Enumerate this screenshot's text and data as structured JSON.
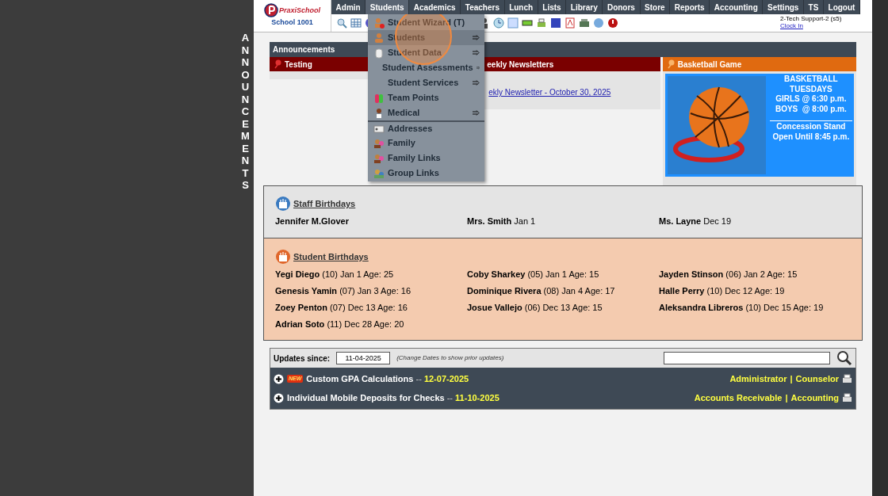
{
  "side_label": "ANNOUNCEMENTS",
  "logo": {
    "brand": "PraxiSchool",
    "school": "School 1001"
  },
  "nav": [
    {
      "label": "Admin",
      "selected": false
    },
    {
      "label": "Students",
      "selected": true
    },
    {
      "label": "Academics",
      "selected": false
    },
    {
      "label": "Teachers",
      "selected": false
    },
    {
      "label": "Lunch",
      "selected": false
    },
    {
      "label": "Lists",
      "selected": false
    },
    {
      "label": "Library",
      "selected": false
    },
    {
      "label": "Donors",
      "selected": false
    },
    {
      "label": "Store",
      "selected": false
    },
    {
      "label": "Reports",
      "selected": false
    },
    {
      "label": "Accounting",
      "selected": false
    },
    {
      "label": "Settings",
      "selected": false
    },
    {
      "label": "TS",
      "selected": false
    },
    {
      "label": "Logout",
      "selected": false
    }
  ],
  "user": {
    "name": "2-Tech Support-2 (s5)",
    "link": "Clock In"
  },
  "menu": [
    {
      "label": "Student Wizard (T)",
      "kind": "wizard",
      "submenu": false,
      "selected": false
    },
    {
      "label": "Students",
      "kind": "person",
      "submenu": true,
      "selected": true
    },
    {
      "label": "Student Data",
      "kind": "data",
      "submenu": true,
      "selected": false
    },
    {
      "label": "Student Assessments",
      "kind": "plain",
      "submenu": true,
      "selected": false
    },
    {
      "label": "Student Services",
      "kind": "plain",
      "submenu": true,
      "selected": false
    },
    {
      "label": "Team Points",
      "kind": "team",
      "submenu": false,
      "selected": false
    },
    {
      "label": "Medical",
      "kind": "medical",
      "submenu": true,
      "selected": false
    },
    {
      "label": "Addresses",
      "kind": "card",
      "submenu": false,
      "selected": false,
      "divider": true
    },
    {
      "label": "Family",
      "kind": "family",
      "submenu": false,
      "selected": false
    },
    {
      "label": "Family Links",
      "kind": "family",
      "submenu": false,
      "selected": false
    },
    {
      "label": "Group Links",
      "kind": "group",
      "submenu": false,
      "selected": false
    }
  ],
  "announcements": {
    "title": "Announcements",
    "columns": [
      {
        "title": "Testing",
        "color": "#7a0000"
      },
      {
        "title": "eekly Newsletters",
        "color": "#7a0000",
        "link": "ekly Newsletter - October 30, 2025"
      },
      {
        "title": "Basketball Game",
        "color": "#e06a10",
        "flyer": [
          "BASKETBALL",
          "TUESDAYS",
          "GIRLS @ 6:30 p.m.",
          "BOYS  @ 8:00 p.m.",
          "Concession Stand",
          "Open Until 8:45 p.m."
        ]
      }
    ]
  },
  "staff_birthdays": {
    "title": "Staff Birthdays",
    "people": [
      {
        "name": "Jennifer M.Glover"
      },
      {
        "name": "Mrs. Smith",
        "detail": "Jan 1"
      },
      {
        "name": "Ms. Layne",
        "detail": "Dec 19"
      }
    ]
  },
  "student_birthdays": {
    "title": "Student Birthdays",
    "people": [
      {
        "name": "Yegi Diego",
        "detail": "(10) Jan 1 Age: 25"
      },
      {
        "name": "Coby Sharkey",
        "detail": "(05) Jan 1 Age: 15"
      },
      {
        "name": "Jayden Stinson",
        "detail": "(06) Jan 2 Age: 15"
      },
      {
        "name": "Genesis Yamin",
        "detail": "(07) Jan 3 Age: 16"
      },
      {
        "name": "Dominique Rivera",
        "detail": "(08) Jan 4 Age: 17"
      },
      {
        "name": "Halle Perry",
        "detail": "(10) Dec 12 Age: 19"
      },
      {
        "name": "Zoey Penton",
        "detail": "(07) Dec 13 Age: 16"
      },
      {
        "name": "Josue Vallejo",
        "detail": "(06) Dec 13 Age: 15"
      },
      {
        "name": "Aleksandra Libreros",
        "detail": "(10) Dec 15 Age: 19"
      },
      {
        "name": "Adrian Soto",
        "detail": "(11) Dec 28 Age: 20"
      }
    ]
  },
  "updates": {
    "label": "Updates since:",
    "date": "11-04-2025",
    "hint": "(Change Dates to show prior updates)",
    "items": [
      {
        "title": "Custom GPA Calculations",
        "date": "12-07-2025",
        "dash": "--",
        "is_new": true,
        "new_label": "NEW",
        "roles": [
          "Administrator",
          "Counselor"
        ],
        "role_separator": "|"
      },
      {
        "title": "Individual Mobile Deposits for Checks",
        "date": "11-10-2025",
        "dash": "--",
        "is_new": false,
        "roles": [
          "Accounts Receivable",
          "Accounting"
        ],
        "role_separator": "|"
      }
    ]
  }
}
